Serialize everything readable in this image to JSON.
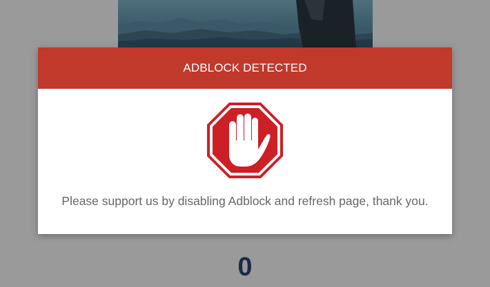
{
  "background": {
    "image_icon": "landscape-image"
  },
  "modal": {
    "title": "ADBLOCK DETECTED",
    "icon": "stop-hand-icon",
    "message": "Please support us by disabling Adblock and refresh page, thank you.",
    "header_color": "#c0392b"
  },
  "counter": {
    "value": "0"
  }
}
